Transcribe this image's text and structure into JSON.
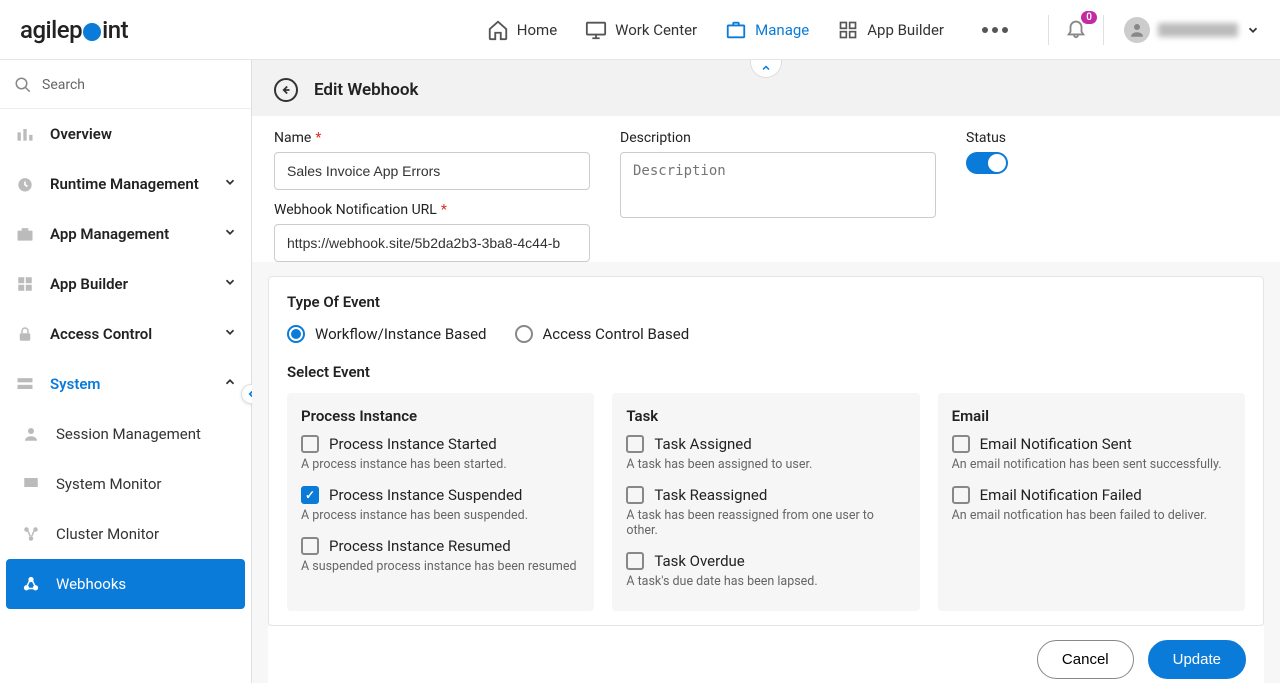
{
  "brand": {
    "pre": "agilep",
    "post": "int"
  },
  "nav": {
    "home": "Home",
    "workcenter": "Work Center",
    "manage": "Manage",
    "appbuilder": "App Builder"
  },
  "notification_count": "0",
  "sidebar": {
    "search_placeholder": "Search",
    "items": {
      "overview": "Overview",
      "runtime": "Runtime Management",
      "appmgmt": "App Management",
      "appbuilder": "App Builder",
      "access": "Access Control",
      "system": "System"
    },
    "system_children": {
      "session": "Session Management",
      "sysmon": "System Monitor",
      "cluster": "Cluster Monitor",
      "webhooks": "Webhooks"
    }
  },
  "page": {
    "title": "Edit Webhook",
    "name_label": "Name",
    "name_value": "Sales Invoice App Errors",
    "url_label": "Webhook Notification URL",
    "url_value": "https://webhook.site/5b2da2b3-3ba8-4c44-b",
    "desc_label": "Description",
    "desc_placeholder": "Description",
    "status_label": "Status"
  },
  "event_type": {
    "heading": "Type Of Event",
    "workflow": "Workflow/Instance Based",
    "access": "Access Control Based",
    "select_label": "Select Event"
  },
  "events": {
    "pi": {
      "title": "Process Instance",
      "started": {
        "label": "Process Instance Started",
        "desc": "A process instance has been started."
      },
      "suspended": {
        "label": "Process Instance Suspended",
        "desc": "A process instance has been suspended."
      },
      "resumed": {
        "label": "Process Instance Resumed",
        "desc": "A suspended process instance has been resumed"
      }
    },
    "task": {
      "title": "Task",
      "assigned": {
        "label": "Task Assigned",
        "desc": "A task has been assigned to user."
      },
      "reassigned": {
        "label": "Task Reassigned",
        "desc": "A task has been reassigned from one user to other."
      },
      "overdue": {
        "label": "Task Overdue",
        "desc": "A task's due date has been lapsed."
      }
    },
    "email": {
      "title": "Email",
      "sent": {
        "label": "Email Notification Sent",
        "desc": "An email notification has been sent successfully."
      },
      "failed": {
        "label": "Email Notification Failed",
        "desc": "An email notfication has been failed to deliver."
      }
    }
  },
  "buttons": {
    "cancel": "Cancel",
    "update": "Update"
  }
}
